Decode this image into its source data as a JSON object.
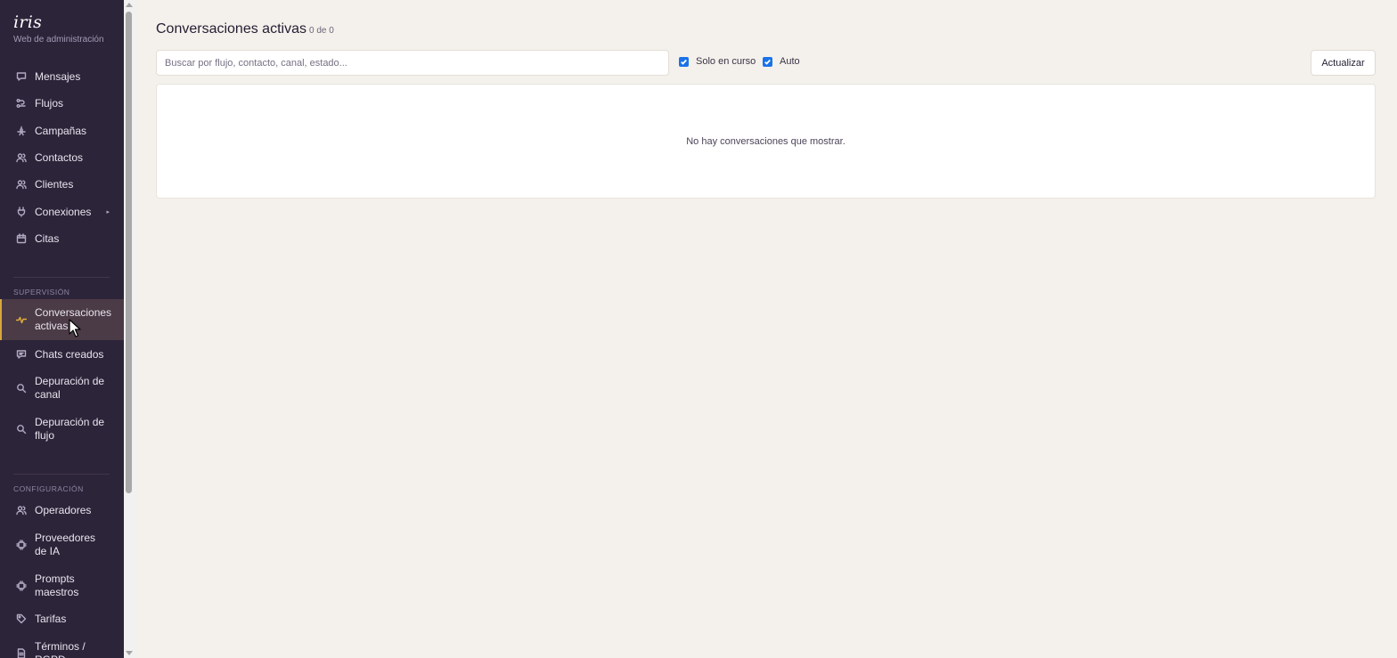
{
  "sidebar": {
    "brand_name": "iris",
    "brand_subtitle": "Web de administración",
    "main_items": [
      {
        "label": "Mensajes",
        "icon": "message-icon"
      },
      {
        "label": "Flujos",
        "icon": "flow-icon"
      },
      {
        "label": "Campañas",
        "icon": "campaign-icon"
      },
      {
        "label": "Contactos",
        "icon": "users-icon"
      },
      {
        "label": "Clientes",
        "icon": "users-icon"
      },
      {
        "label": "Conexiones",
        "icon": "plug-icon",
        "caret": "▸"
      },
      {
        "label": "Citas",
        "icon": "calendar-icon"
      }
    ],
    "supervision_label": "SUPERVISIÓN",
    "supervision_items": [
      {
        "label": "Conversaciones activas",
        "icon": "activity-icon",
        "active": true
      },
      {
        "label": "Chats creados",
        "icon": "chat-icon"
      },
      {
        "label": "Depuración de canal",
        "icon": "search-icon"
      },
      {
        "label": "Depuración de flujo",
        "icon": "search-icon"
      }
    ],
    "config_label": "CONFIGURACIÓN",
    "config_items": [
      {
        "label": "Operadores",
        "icon": "users-icon"
      },
      {
        "label": "Proveedores de IA",
        "icon": "chip-icon"
      },
      {
        "label": "Prompts maestros",
        "icon": "chip-icon"
      },
      {
        "label": "Tarifas",
        "icon": "tag-icon"
      },
      {
        "label": "Términos / RGPD",
        "icon": "document-icon"
      }
    ],
    "active_accent": "#d8a73b",
    "background": "#2c2439"
  },
  "main": {
    "title": "Conversaciones activas",
    "count": "0 de 0",
    "search_placeholder": "Buscar por flujo, contacto, canal, estado...",
    "search_value": "",
    "filter_in_progress": {
      "label": "Solo en curso",
      "checked": true
    },
    "filter_auto": {
      "label": "Auto",
      "checked": true
    },
    "refresh_label": "Actualizar",
    "empty_message": "No hay conversaciones que mostrar."
  }
}
